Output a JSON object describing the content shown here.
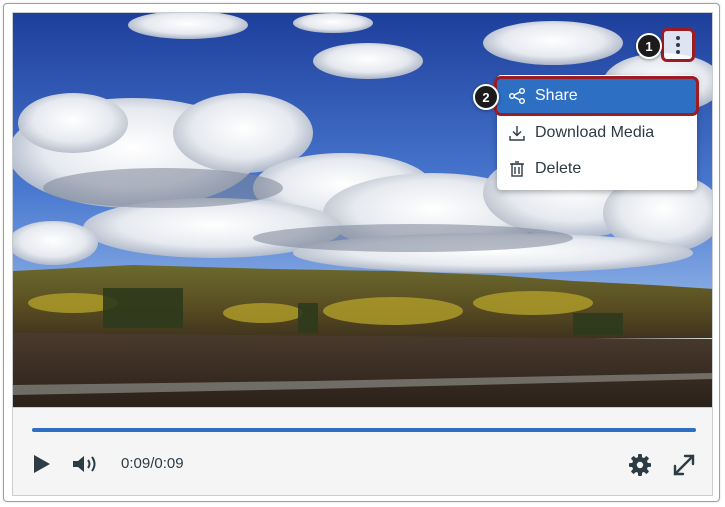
{
  "player": {
    "time": "0:09/0:09",
    "progress": 1.0,
    "accent_color": "#2d6fc3",
    "highlight_color": "#9b1c22"
  },
  "callouts": {
    "one": "1",
    "two": "2"
  },
  "menu": {
    "items": [
      {
        "label": "Share",
        "icon": "share-icon",
        "active": true
      },
      {
        "label": "Download Media",
        "icon": "download-icon",
        "active": false
      },
      {
        "label": "Delete",
        "icon": "trash-icon",
        "active": false
      }
    ]
  },
  "icons": {
    "play": "play-icon",
    "volume": "volume-icon",
    "settings": "gear-icon",
    "fullscreen": "fullscreen-icon",
    "options": "kebab-icon"
  }
}
